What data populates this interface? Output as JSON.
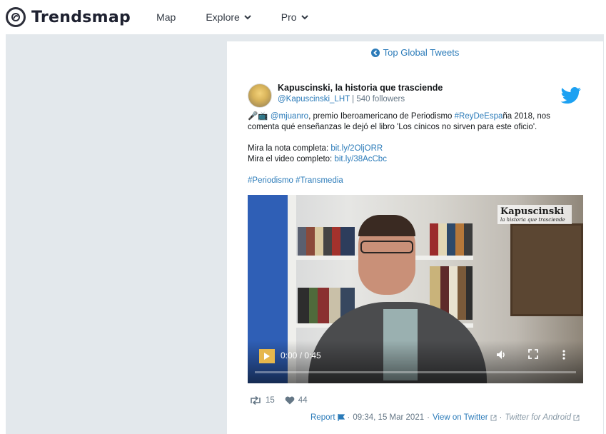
{
  "nav": {
    "logo_text": "Trendsmap",
    "items": [
      {
        "label": "Map"
      },
      {
        "label": "Explore"
      },
      {
        "label": "Pro"
      }
    ]
  },
  "feed": {
    "top_link": "Top Global Tweets"
  },
  "tweet": {
    "author_name": "Kapuscinski, la historia que trasciende",
    "handle": "@Kapuscinski_LHT",
    "followers": "540 followers",
    "text": {
      "emoji": "🎤📺",
      "mention": "@mjuanro",
      "part1": ", premio Iberoamericano de Periodismo ",
      "hashtag_rey": "#ReyDeEspa",
      "part2": "ña 2018, nos",
      "line2": "comenta qué enseñanzas le dejó el libro 'Los cínicos no sirven para este oficio'.",
      "nota_label": "Mira la nota completa: ",
      "nota_link": "bit.ly/2OljORR",
      "video_label": "Mira el video completo: ",
      "video_link": "bit.ly/38AcCbc",
      "hashtags": "#Periodismo #Transmedia"
    },
    "video": {
      "watermark": "Kapuscinski",
      "watermark_sub": "la historia que trasciende",
      "time": "0:00 / 0:45",
      "progress": 0
    },
    "retweets": "15",
    "likes": "44",
    "footer": {
      "report": "Report",
      "timestamp": "09:34, 15 Mar 2021",
      "view_on": "View on Twitter",
      "via": "Twitter for Android"
    }
  },
  "colors": {
    "link": "#2b7bb9",
    "background": "#e3e8ec",
    "twitter_blue": "#1da1f2"
  }
}
